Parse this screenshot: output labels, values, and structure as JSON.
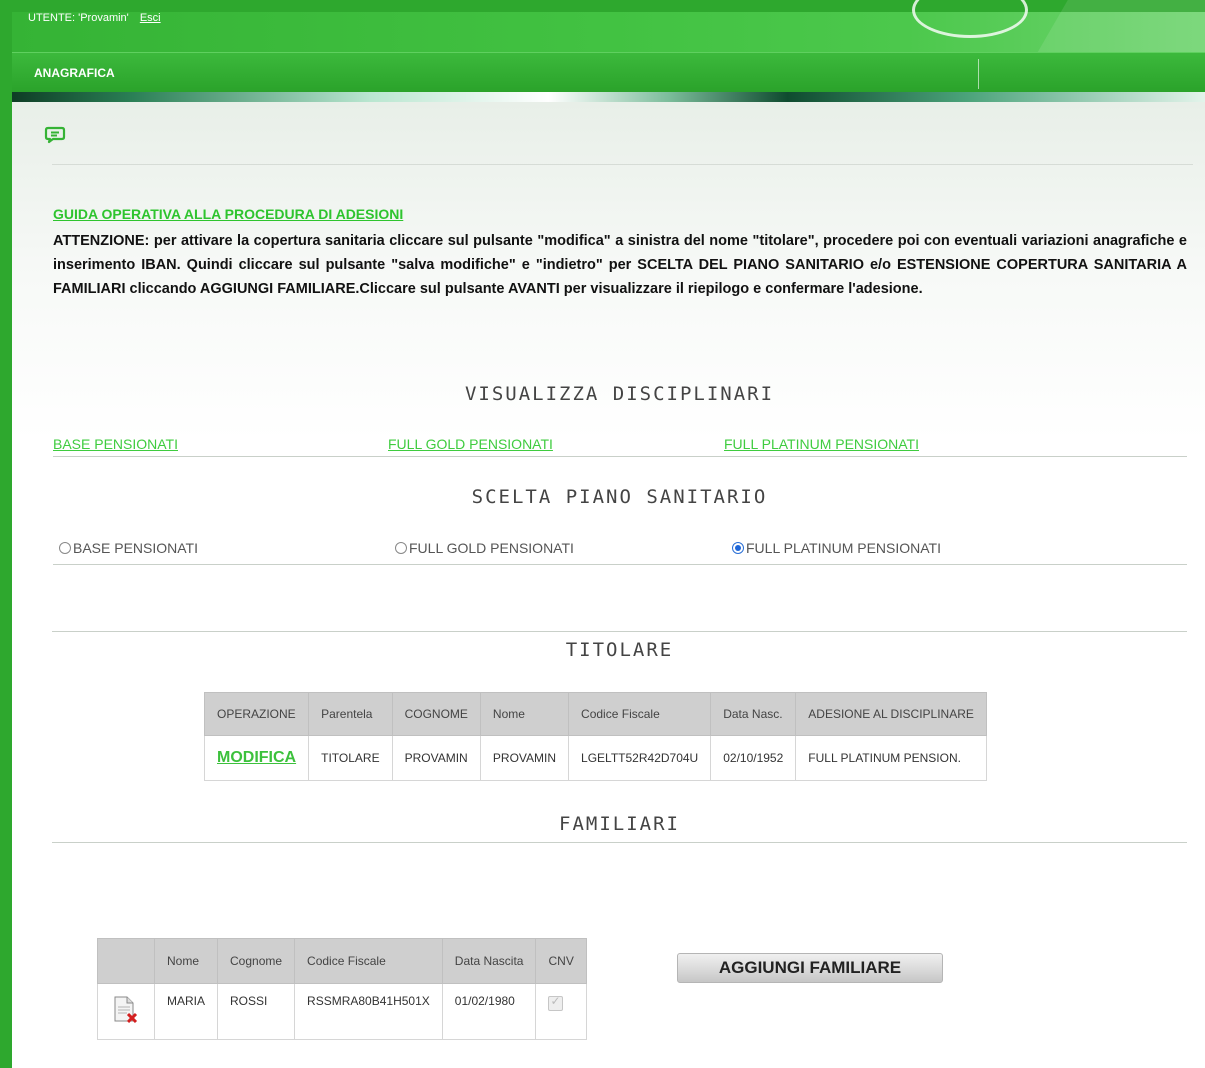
{
  "header": {
    "user_label": "UTENTE: 'Provamin'",
    "logout_label": "Esci",
    "nav_title": "ANAGRAFICA"
  },
  "guide": {
    "link": "GUIDA OPERATIVA ALLA PROCEDURA DI ADESIONI",
    "notice": "ATTENZIONE: per attivare la copertura sanitaria cliccare sul pulsante \"modifica\" a sinistra del nome \"titolare\", procedere poi con eventuali variazioni anagrafiche e inserimento IBAN. Quindi cliccare sul pulsante \"salva modifiche\" e \"indietro\" per SCELTA DEL PIANO SANITARIO e/o ESTENSIONE COPERTURA SANITARIA A FAMILIARI cliccando AGGIUNGI FAMILIARE.Cliccare sul pulsante AVANTI per visualizzare il riepilogo e confermare l'adesione."
  },
  "disciplinari": {
    "title": "VISUALIZZA DISCIPLINARI",
    "links": [
      "BASE PENSIONATI",
      "FULL GOLD PENSIONATI",
      "FULL PLATINUM PENSIONATI"
    ]
  },
  "piano": {
    "title": "SCELTA PIANO SANITARIO",
    "options": [
      "BASE PENSIONATI",
      "FULL GOLD PENSIONATI",
      "FULL PLATINUM PENSIONATI"
    ],
    "selected": "FULL PLATINUM PENSIONATI"
  },
  "titolare": {
    "title": "TITOLARE",
    "headers": [
      "OPERAZIONE",
      "Parentela",
      "COGNOME",
      "Nome",
      "Codice Fiscale",
      "Data Nasc.",
      "ADESIONE AL DISCIPLINARE"
    ],
    "row": {
      "action": "MODIFICA",
      "parentela": "TITOLARE",
      "cognome": "PROVAMIN",
      "nome": "PROVAMIN",
      "codice_fiscale": "LGELTT52R42D704U",
      "data_nascita": "02/10/1952",
      "adesione": "FULL PLATINUM PENSION."
    }
  },
  "familiari": {
    "title": "FAMILIARI",
    "headers": [
      "",
      "Nome",
      "Cognome",
      "Codice Fiscale",
      "Data Nascita",
      "CNV"
    ],
    "row": {
      "nome": "MARIA",
      "cognome": "ROSSI",
      "codice_fiscale": "RSSMRA80B41H501X",
      "data_nascita": "01/02/1980",
      "cnv": true
    },
    "add_button": "AGGIUNGI FAMILIARE"
  },
  "colors": {
    "brand_green": "#2ea82e",
    "link_green": "#3fcc3f",
    "radio_blue": "#1d66d9"
  }
}
